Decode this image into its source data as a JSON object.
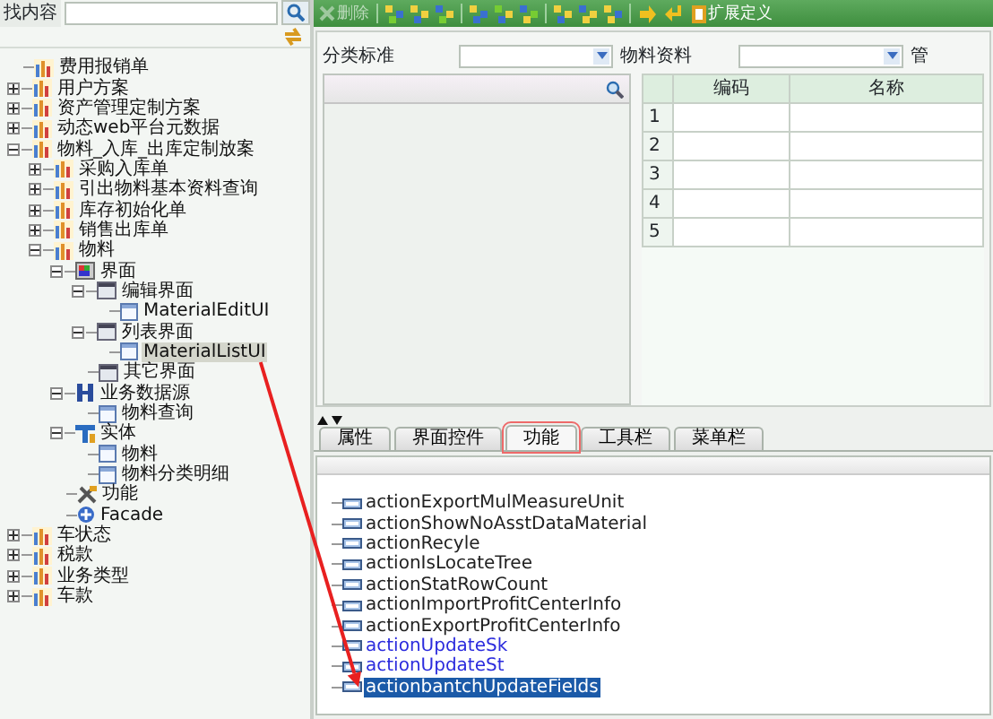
{
  "search": {
    "label": "找内容"
  },
  "tree": [
    {
      "label": "费用报销单",
      "kind": "chart",
      "selected": false
    },
    {
      "label": "用户方案",
      "kind": "chart",
      "expanded": false,
      "selected": false
    },
    {
      "label": "资产管理定制方案",
      "kind": "chart",
      "expanded": false,
      "selected": false
    },
    {
      "label": "动态web平台元数据",
      "kind": "chart",
      "expanded": false,
      "selected": false
    },
    {
      "label": "物料_入库_出库定制放案",
      "kind": "chart",
      "expanded": true,
      "selected": false,
      "children": [
        {
          "label": "采购入库单",
          "kind": "chart",
          "expanded": false,
          "selected": false
        },
        {
          "label": "引出物料基本资料查询",
          "kind": "chart",
          "expanded": false,
          "selected": false
        },
        {
          "label": "库存初始化单",
          "kind": "chart",
          "expanded": false,
          "selected": false
        },
        {
          "label": "销售出库单",
          "kind": "chart",
          "expanded": false,
          "selected": false
        },
        {
          "label": "物料",
          "kind": "chart",
          "expanded": true,
          "selected": false,
          "children": [
            {
              "label": "界面",
              "kind": "ui",
              "expanded": true,
              "selected": false,
              "children": [
                {
                  "label": "编辑界面",
                  "kind": "window",
                  "expanded": true,
                  "selected": false,
                  "children": [
                    {
                      "label": "MaterialEditUI",
                      "kind": "page",
                      "selected": false
                    }
                  ]
                },
                {
                  "label": "列表界面",
                  "kind": "window",
                  "expanded": true,
                  "selected": false,
                  "children": [
                    {
                      "label": "MaterialListUI",
                      "kind": "page",
                      "selected": true
                    }
                  ]
                },
                {
                  "label": "其它界面",
                  "kind": "window",
                  "selected": false
                }
              ]
            },
            {
              "label": "业务数据源",
              "kind": "datasource",
              "expanded": true,
              "selected": false,
              "children": [
                {
                  "label": "物料查询",
                  "kind": "page",
                  "selected": false
                }
              ]
            },
            {
              "label": "实体",
              "kind": "entity",
              "expanded": true,
              "selected": false,
              "children": [
                {
                  "label": "物料",
                  "kind": "page",
                  "selected": false
                },
                {
                  "label": "物料分类明细",
                  "kind": "page",
                  "selected": false
                }
              ]
            },
            {
              "label": "功能",
              "kind": "tools",
              "selected": false
            },
            {
              "label": "Facade",
              "kind": "facade",
              "selected": false
            }
          ]
        }
      ]
    },
    {
      "label": "车状态",
      "kind": "chart",
      "expanded": false,
      "selected": false
    },
    {
      "label": "税款",
      "kind": "chart",
      "expanded": false,
      "selected": false
    },
    {
      "label": "业务类型",
      "kind": "chart",
      "expanded": false,
      "selected": false
    },
    {
      "label": "车款",
      "kind": "chart",
      "expanded": false,
      "selected": false
    }
  ],
  "toolbar": {
    "delete": {
      "label": "删除",
      "disabled": true
    },
    "extend": {
      "label": "扩展定义"
    }
  },
  "filters": [
    {
      "label": "分类标准"
    },
    {
      "label": "物料资料"
    },
    {
      "label": "管"
    }
  ],
  "grid": {
    "columns": [
      "编码",
      "名称"
    ],
    "rows": [
      "1",
      "2",
      "3",
      "4",
      "5"
    ]
  },
  "tabs": [
    {
      "label": "属性",
      "selected": false,
      "highlighted": false
    },
    {
      "label": "界面控件",
      "selected": false,
      "highlighted": false
    },
    {
      "label": "功能",
      "selected": true,
      "highlighted": true
    },
    {
      "label": "工具栏",
      "selected": false,
      "highlighted": false
    },
    {
      "label": "菜单栏",
      "selected": false,
      "highlighted": false
    }
  ],
  "actions": [
    {
      "label": "actionExportMulMeasureUnit",
      "custom": false,
      "selected": false
    },
    {
      "label": "actionShowNoAsstDataMaterial",
      "custom": false,
      "selected": false
    },
    {
      "label": "actionRecyle",
      "custom": false,
      "selected": false
    },
    {
      "label": "actionIsLocateTree",
      "custom": false,
      "selected": false
    },
    {
      "label": "actionStatRowCount",
      "custom": false,
      "selected": false
    },
    {
      "label": "actionImportProfitCenterInfo",
      "custom": false,
      "selected": false
    },
    {
      "label": "actionExportProfitCenterInfo",
      "custom": false,
      "selected": false
    },
    {
      "label": "actionUpdateSk",
      "custom": true,
      "selected": false
    },
    {
      "label": "actionUpdateSt",
      "custom": true,
      "selected": false
    },
    {
      "label": "actionbantchUpdateFields",
      "custom": false,
      "selected": true
    }
  ],
  "annotation_arrow": true
}
